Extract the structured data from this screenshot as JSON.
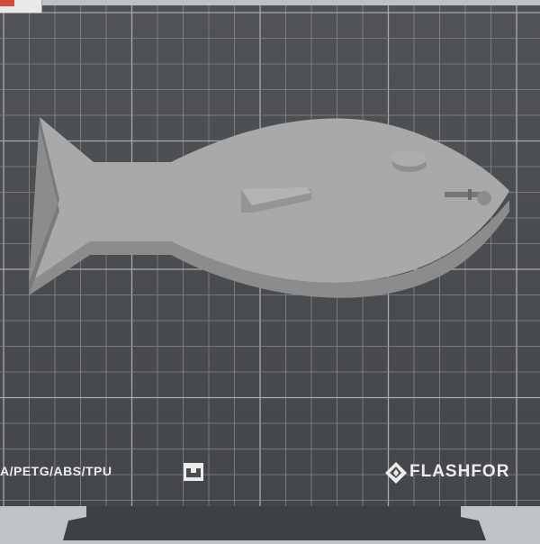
{
  "app": {
    "viewport": "3D build plate view",
    "bed": {
      "materials_label": "A/PETG/ABS/TPU",
      "brand_label": "FLASHFOR",
      "brand_logo_icon": "flashforge-logo-icon",
      "bed_marker_icon": "bed-marker-icon"
    },
    "model": {
      "name_icon": "fish-model"
    },
    "toolbar": {
      "tool_icon": "pen-tool-icon"
    },
    "colors": {
      "bed": "#4a4d50",
      "grid": "#84888b",
      "grid_major": "#a7abae",
      "model": "#a9a9a9",
      "model_side": "#8c8c8c",
      "background": "#bfc3c6",
      "holder": "#3e4143"
    }
  }
}
